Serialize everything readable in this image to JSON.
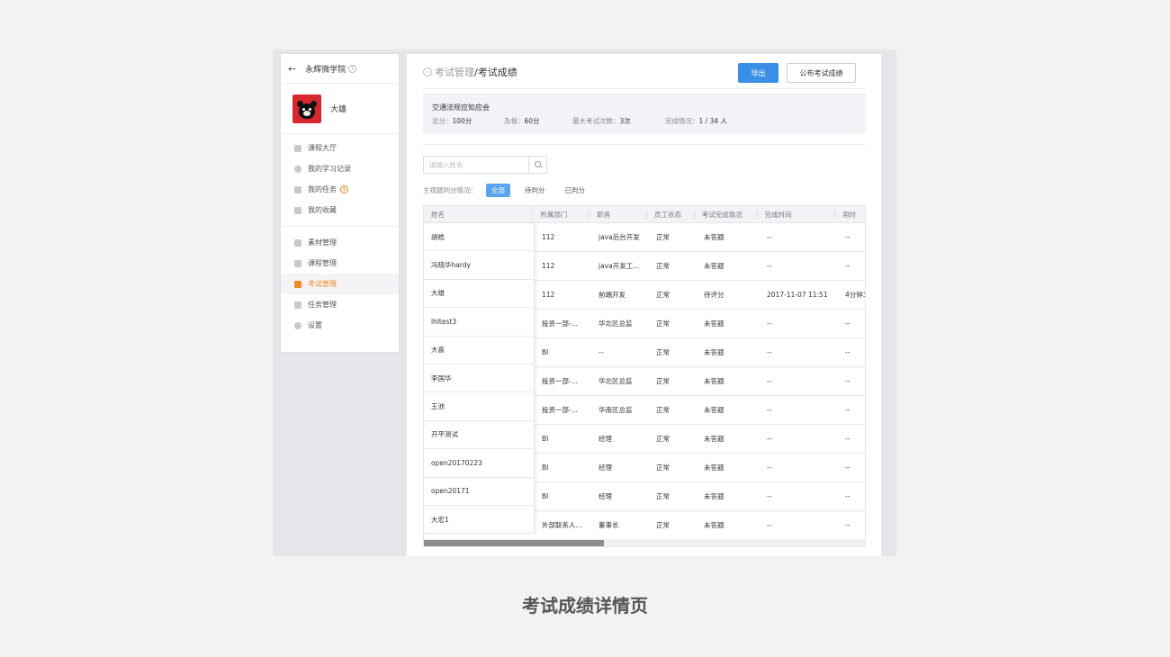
{
  "sidebar": {
    "school_name": "永辉微学院",
    "username": "大雄",
    "nav_group1": [
      {
        "label": "课程大厅",
        "icon": "hall-icon"
      },
      {
        "label": "我的学习记录",
        "icon": "clock-icon"
      },
      {
        "label": "我的任务",
        "icon": "task-icon",
        "badge": "$"
      },
      {
        "label": "我的收藏",
        "icon": "folder-icon"
      }
    ],
    "nav_group2": [
      {
        "label": "素材管理",
        "icon": "material-icon"
      },
      {
        "label": "课程管理",
        "icon": "course-icon"
      },
      {
        "label": "考试管理",
        "icon": "exam-icon",
        "active": true
      },
      {
        "label": "任务管理",
        "icon": "task-manage-icon"
      },
      {
        "label": "设置",
        "icon": "gear-icon"
      }
    ]
  },
  "header": {
    "breadcrumb_parent": "考试管理",
    "breadcrumb_sep": "/",
    "breadcrumb_current": "考试成绩",
    "export_label": "导出",
    "publish_label": "公布考试成绩"
  },
  "exam": {
    "title": "交通法规应知应会",
    "total_label": "总分：",
    "total_value": "100分",
    "pass_label": "及格：",
    "pass_value": "60分",
    "max_attempts_label": "最大考试次数：",
    "max_attempts_value": "3次",
    "completion_label": "完成情况：",
    "completion_value": "1 / 34 人"
  },
  "search": {
    "placeholder": "请输入姓名"
  },
  "filter": {
    "label": "主观题判分情况：",
    "options": [
      "全部",
      "待判分",
      "已判分"
    ],
    "selected": "全部"
  },
  "table": {
    "columns": [
      "姓名",
      "所属部门",
      "职务",
      "员工状态",
      "考试完成情况",
      "完成时间",
      "用时"
    ],
    "rows": [
      [
        "胡皓",
        "112",
        "java后台开发",
        "正常",
        "未答题",
        "--",
        "--"
      ],
      [
        "冯晓华hardy",
        "112",
        "java开发工...",
        "正常",
        "未答题",
        "--",
        "--"
      ],
      [
        "大雄",
        "112",
        "前端开发",
        "正常",
        "待评分",
        "2017-11-07 11:51",
        "4分钟3"
      ],
      [
        "lhltest3",
        "投资一部-...",
        "华北区总监",
        "正常",
        "未答题",
        "--",
        "--"
      ],
      [
        "大喜",
        "BI",
        "--",
        "正常",
        "未答题",
        "--",
        "--"
      ],
      [
        "李国华",
        "投资一部-...",
        "华北区总监",
        "正常",
        "未答题",
        "--",
        "--"
      ],
      [
        "王池",
        "投资一部-...",
        "华南区总监",
        "正常",
        "未答题",
        "--",
        "--"
      ],
      [
        "开平测试",
        "BI",
        "经理",
        "正常",
        "未答题",
        "--",
        "--"
      ],
      [
        "open20170223",
        "BI",
        "经理",
        "正常",
        "未答题",
        "--",
        "--"
      ],
      [
        "open20171",
        "BI",
        "经理",
        "正常",
        "未答题",
        "--",
        "--"
      ],
      [
        "大宏1",
        "外部联系人...",
        "董事长",
        "正常",
        "未答题",
        "--",
        "--"
      ]
    ]
  },
  "caption": "考试成绩详情页",
  "colors": {
    "primary": "#3a8ee6",
    "active_nav": "#f08a24",
    "chip_active": "#5aa3ef"
  }
}
